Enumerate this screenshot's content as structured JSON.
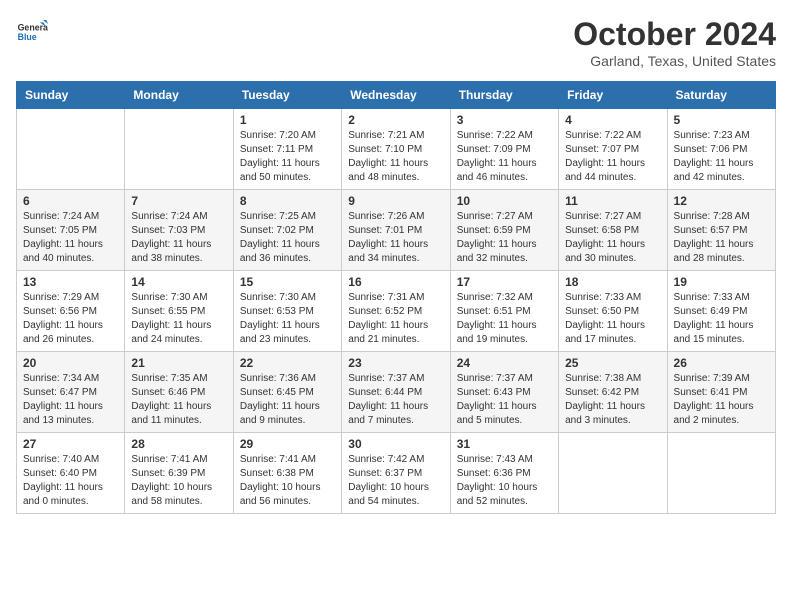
{
  "header": {
    "logo_general": "General",
    "logo_blue": "Blue",
    "month": "October 2024",
    "location": "Garland, Texas, United States"
  },
  "days_of_week": [
    "Sunday",
    "Monday",
    "Tuesday",
    "Wednesday",
    "Thursday",
    "Friday",
    "Saturday"
  ],
  "weeks": [
    [
      {
        "day": "",
        "info": ""
      },
      {
        "day": "",
        "info": ""
      },
      {
        "day": "1",
        "info": "Sunrise: 7:20 AM\nSunset: 7:11 PM\nDaylight: 11 hours and 50 minutes."
      },
      {
        "day": "2",
        "info": "Sunrise: 7:21 AM\nSunset: 7:10 PM\nDaylight: 11 hours and 48 minutes."
      },
      {
        "day": "3",
        "info": "Sunrise: 7:22 AM\nSunset: 7:09 PM\nDaylight: 11 hours and 46 minutes."
      },
      {
        "day": "4",
        "info": "Sunrise: 7:22 AM\nSunset: 7:07 PM\nDaylight: 11 hours and 44 minutes."
      },
      {
        "day": "5",
        "info": "Sunrise: 7:23 AM\nSunset: 7:06 PM\nDaylight: 11 hours and 42 minutes."
      }
    ],
    [
      {
        "day": "6",
        "info": "Sunrise: 7:24 AM\nSunset: 7:05 PM\nDaylight: 11 hours and 40 minutes."
      },
      {
        "day": "7",
        "info": "Sunrise: 7:24 AM\nSunset: 7:03 PM\nDaylight: 11 hours and 38 minutes."
      },
      {
        "day": "8",
        "info": "Sunrise: 7:25 AM\nSunset: 7:02 PM\nDaylight: 11 hours and 36 minutes."
      },
      {
        "day": "9",
        "info": "Sunrise: 7:26 AM\nSunset: 7:01 PM\nDaylight: 11 hours and 34 minutes."
      },
      {
        "day": "10",
        "info": "Sunrise: 7:27 AM\nSunset: 6:59 PM\nDaylight: 11 hours and 32 minutes."
      },
      {
        "day": "11",
        "info": "Sunrise: 7:27 AM\nSunset: 6:58 PM\nDaylight: 11 hours and 30 minutes."
      },
      {
        "day": "12",
        "info": "Sunrise: 7:28 AM\nSunset: 6:57 PM\nDaylight: 11 hours and 28 minutes."
      }
    ],
    [
      {
        "day": "13",
        "info": "Sunrise: 7:29 AM\nSunset: 6:56 PM\nDaylight: 11 hours and 26 minutes."
      },
      {
        "day": "14",
        "info": "Sunrise: 7:30 AM\nSunset: 6:55 PM\nDaylight: 11 hours and 24 minutes."
      },
      {
        "day": "15",
        "info": "Sunrise: 7:30 AM\nSunset: 6:53 PM\nDaylight: 11 hours and 23 minutes."
      },
      {
        "day": "16",
        "info": "Sunrise: 7:31 AM\nSunset: 6:52 PM\nDaylight: 11 hours and 21 minutes."
      },
      {
        "day": "17",
        "info": "Sunrise: 7:32 AM\nSunset: 6:51 PM\nDaylight: 11 hours and 19 minutes."
      },
      {
        "day": "18",
        "info": "Sunrise: 7:33 AM\nSunset: 6:50 PM\nDaylight: 11 hours and 17 minutes."
      },
      {
        "day": "19",
        "info": "Sunrise: 7:33 AM\nSunset: 6:49 PM\nDaylight: 11 hours and 15 minutes."
      }
    ],
    [
      {
        "day": "20",
        "info": "Sunrise: 7:34 AM\nSunset: 6:47 PM\nDaylight: 11 hours and 13 minutes."
      },
      {
        "day": "21",
        "info": "Sunrise: 7:35 AM\nSunset: 6:46 PM\nDaylight: 11 hours and 11 minutes."
      },
      {
        "day": "22",
        "info": "Sunrise: 7:36 AM\nSunset: 6:45 PM\nDaylight: 11 hours and 9 minutes."
      },
      {
        "day": "23",
        "info": "Sunrise: 7:37 AM\nSunset: 6:44 PM\nDaylight: 11 hours and 7 minutes."
      },
      {
        "day": "24",
        "info": "Sunrise: 7:37 AM\nSunset: 6:43 PM\nDaylight: 11 hours and 5 minutes."
      },
      {
        "day": "25",
        "info": "Sunrise: 7:38 AM\nSunset: 6:42 PM\nDaylight: 11 hours and 3 minutes."
      },
      {
        "day": "26",
        "info": "Sunrise: 7:39 AM\nSunset: 6:41 PM\nDaylight: 11 hours and 2 minutes."
      }
    ],
    [
      {
        "day": "27",
        "info": "Sunrise: 7:40 AM\nSunset: 6:40 PM\nDaylight: 11 hours and 0 minutes."
      },
      {
        "day": "28",
        "info": "Sunrise: 7:41 AM\nSunset: 6:39 PM\nDaylight: 10 hours and 58 minutes."
      },
      {
        "day": "29",
        "info": "Sunrise: 7:41 AM\nSunset: 6:38 PM\nDaylight: 10 hours and 56 minutes."
      },
      {
        "day": "30",
        "info": "Sunrise: 7:42 AM\nSunset: 6:37 PM\nDaylight: 10 hours and 54 minutes."
      },
      {
        "day": "31",
        "info": "Sunrise: 7:43 AM\nSunset: 6:36 PM\nDaylight: 10 hours and 52 minutes."
      },
      {
        "day": "",
        "info": ""
      },
      {
        "day": "",
        "info": ""
      }
    ]
  ]
}
